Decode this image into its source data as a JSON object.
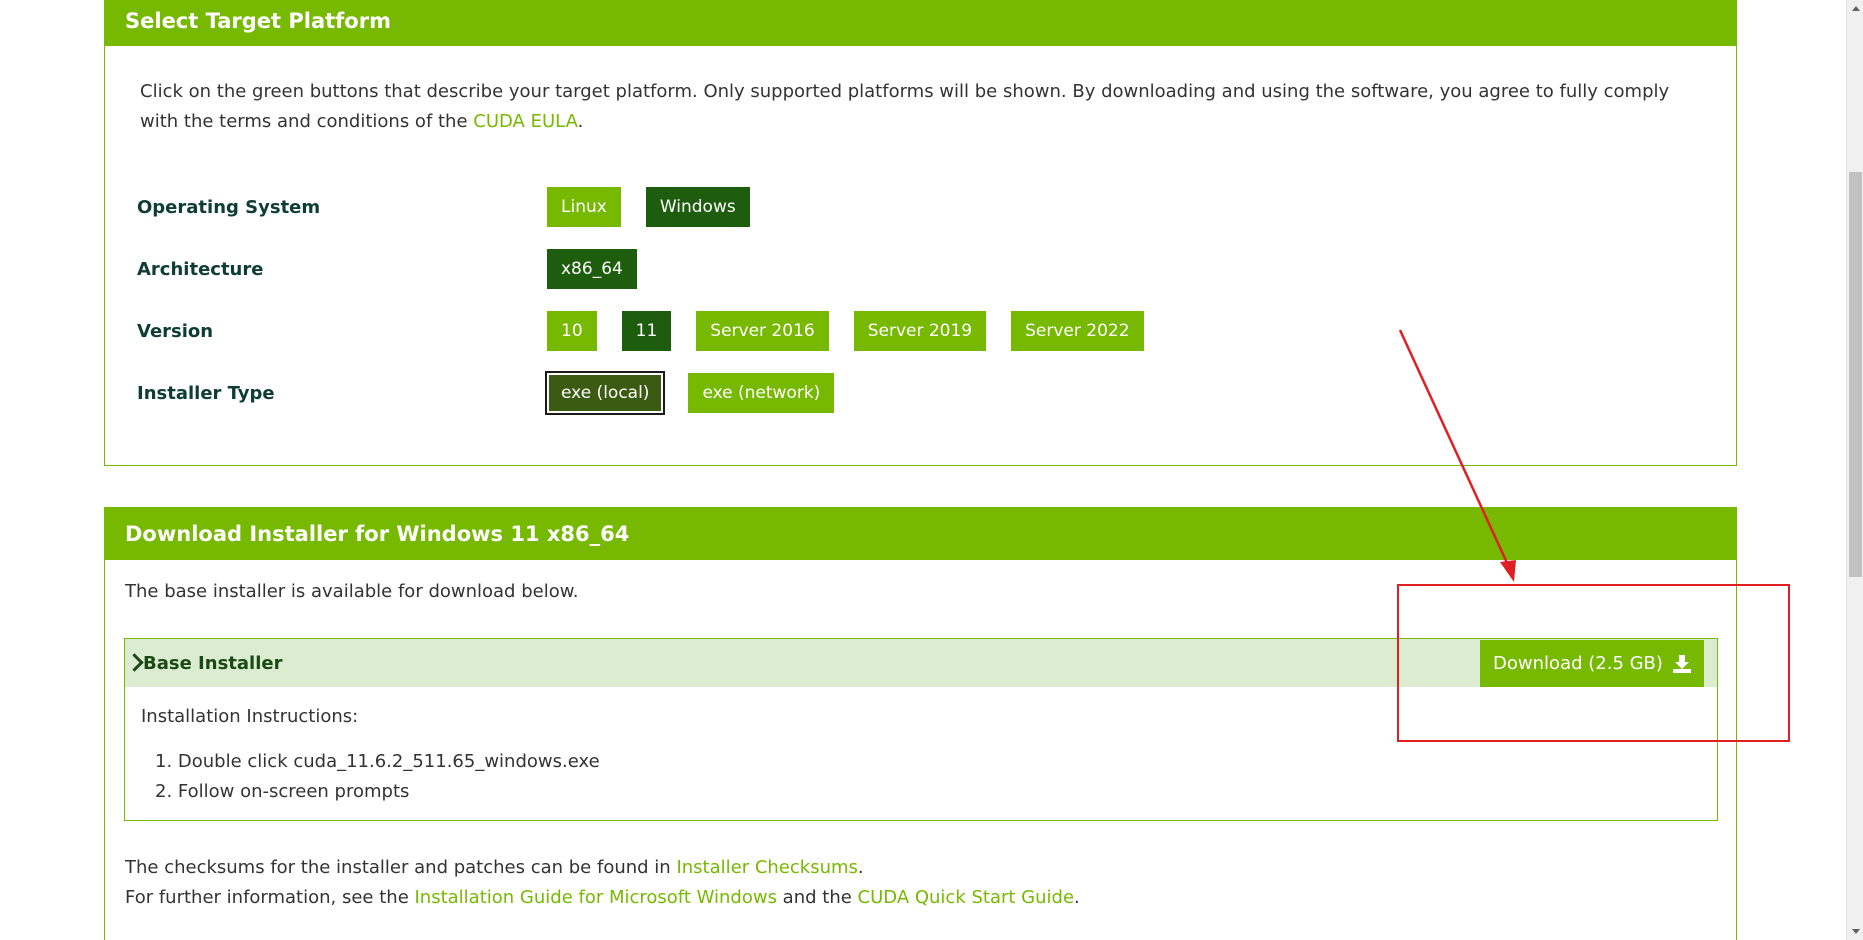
{
  "target": {
    "header": "Select Target Platform",
    "intro_before": "Click on the green buttons that describe your target platform. Only supported platforms will be shown. By downloading and using the software, you agree to fully comply with the terms and conditions of the ",
    "eula_link": "CUDA EULA",
    "intro_after": ".",
    "rows": {
      "os": {
        "label": "Operating System",
        "options": [
          "Linux",
          "Windows"
        ],
        "selected": "Windows"
      },
      "arch": {
        "label": "Architecture",
        "options": [
          "x86_64"
        ],
        "selected": "x86_64"
      },
      "version": {
        "label": "Version",
        "options": [
          "10",
          "11",
          "Server 2016",
          "Server 2019",
          "Server 2022"
        ],
        "selected": "11"
      },
      "installer": {
        "label": "Installer Type",
        "options": [
          "exe (local)",
          "exe (network)"
        ],
        "selected": "exe (local)"
      }
    }
  },
  "download": {
    "header": "Download Installer for Windows 11 x86_64",
    "note": "The base installer is available for download below.",
    "base": {
      "title": "Base Installer",
      "button_label": "Download (2.5 GB)",
      "instructions_title": "Installation Instructions:",
      "steps": [
        "1. Double click cuda_11.6.2_511.65_windows.exe",
        "2. Follow on-screen prompts"
      ]
    },
    "footer": {
      "line1_before": "The checksums for the installer and patches can be found in ",
      "line1_link": "Installer Checksums",
      "line1_after": ".",
      "line2_before": "For further information, see the ",
      "line2_link1": "Installation Guide for Microsoft Windows",
      "line2_mid": " and the ",
      "line2_link2": "CUDA Quick Start Guide",
      "line2_after": "."
    }
  },
  "colors": {
    "brand_green": "#76b900",
    "selected_green": "#1d5d0d",
    "annotation_red": "#e02020"
  }
}
